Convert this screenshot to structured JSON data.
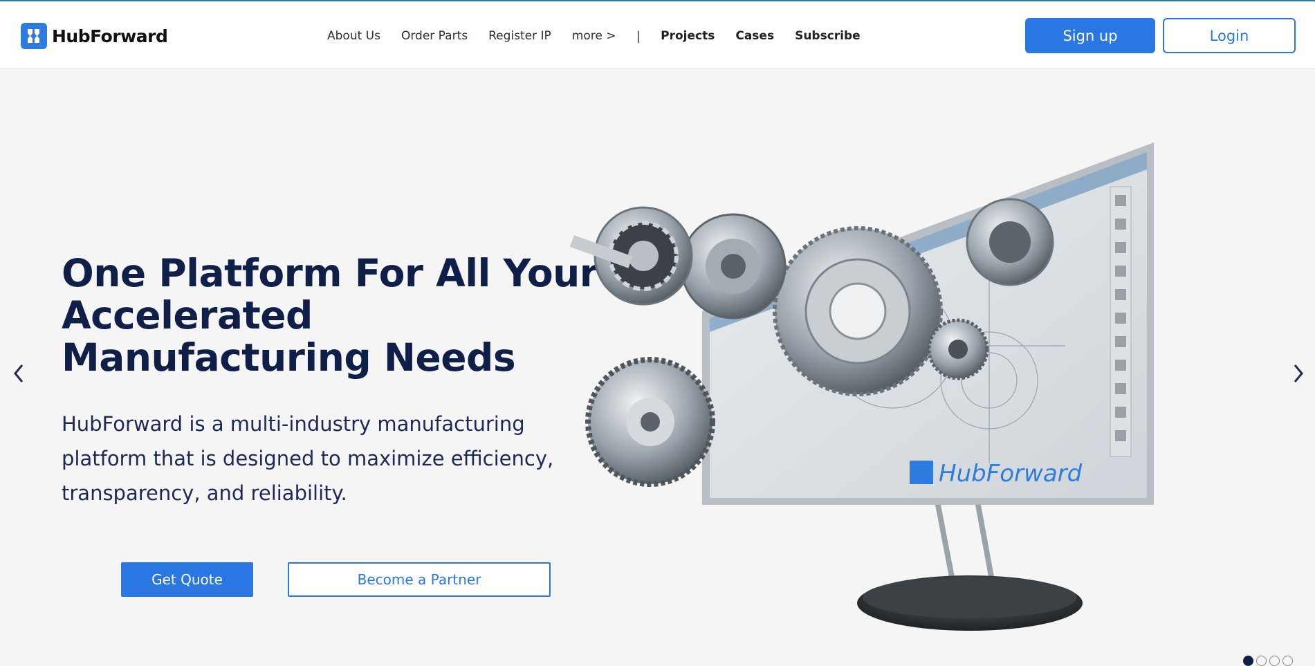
{
  "brand": {
    "name": "HubForward",
    "accent": "#2a77e4",
    "dark": "#0f1f47"
  },
  "nav": {
    "items": [
      {
        "label": "About Us",
        "bold": false
      },
      {
        "label": "Order Parts",
        "bold": false
      },
      {
        "label": "Register IP",
        "bold": false
      },
      {
        "label": "more >",
        "bold": false
      }
    ],
    "separator": "|",
    "bold_items": [
      {
        "label": "Projects"
      },
      {
        "label": "Cases"
      },
      {
        "label": "Subscribe"
      }
    ]
  },
  "auth": {
    "signup_label": "Sign up",
    "login_label": "Login"
  },
  "hero": {
    "title_line1": "One Platform For All Your",
    "title_line2": "Accelerated",
    "title_line3": "Manufacturing Needs",
    "description": "HubForward is a multi-industry manufacturing platform that is designed to maximize efficiency, transparency, and reliability.",
    "quote_label": "Get Quote",
    "partner_label": "Become a Partner",
    "monitor_brand": "HubForward"
  },
  "carousel": {
    "slides": 4,
    "active": 1
  },
  "icons": [
    "logo-mark-icon",
    "chevron-left-icon",
    "chevron-right-icon"
  ]
}
